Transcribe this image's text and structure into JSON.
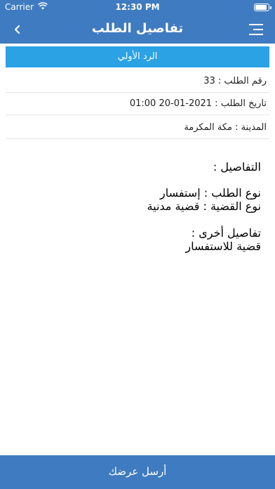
{
  "status_bar": {
    "carrier": "Carrier",
    "time": "12:30 PM",
    "battery_level": 0.95
  },
  "nav": {
    "title": "تفاصيل الطلب",
    "back_icon": "chevron-left-icon",
    "menu_icon": "menu-icon"
  },
  "reply_banner": {
    "label": "الرد الأولي"
  },
  "info": {
    "request_number": "رقم الطلب : 33",
    "request_date": "تاريخ الطلب : 2021-01-20 01:00",
    "city": "المدينة : مكة المكرمة"
  },
  "details": {
    "heading": "التفاصيل  :",
    "request_type": "نوع الطلب :  إستفسار",
    "case_type": "نوع القضية :  قضية مدنية",
    "other_heading": "تفاصيل أخرى :",
    "other_text": "قضية للاستفسار"
  },
  "footer": {
    "submit_label": "أرسل عرضك"
  },
  "colors": {
    "header_blue": "#3f7bc0",
    "banner_blue": "#2aa2e4"
  }
}
